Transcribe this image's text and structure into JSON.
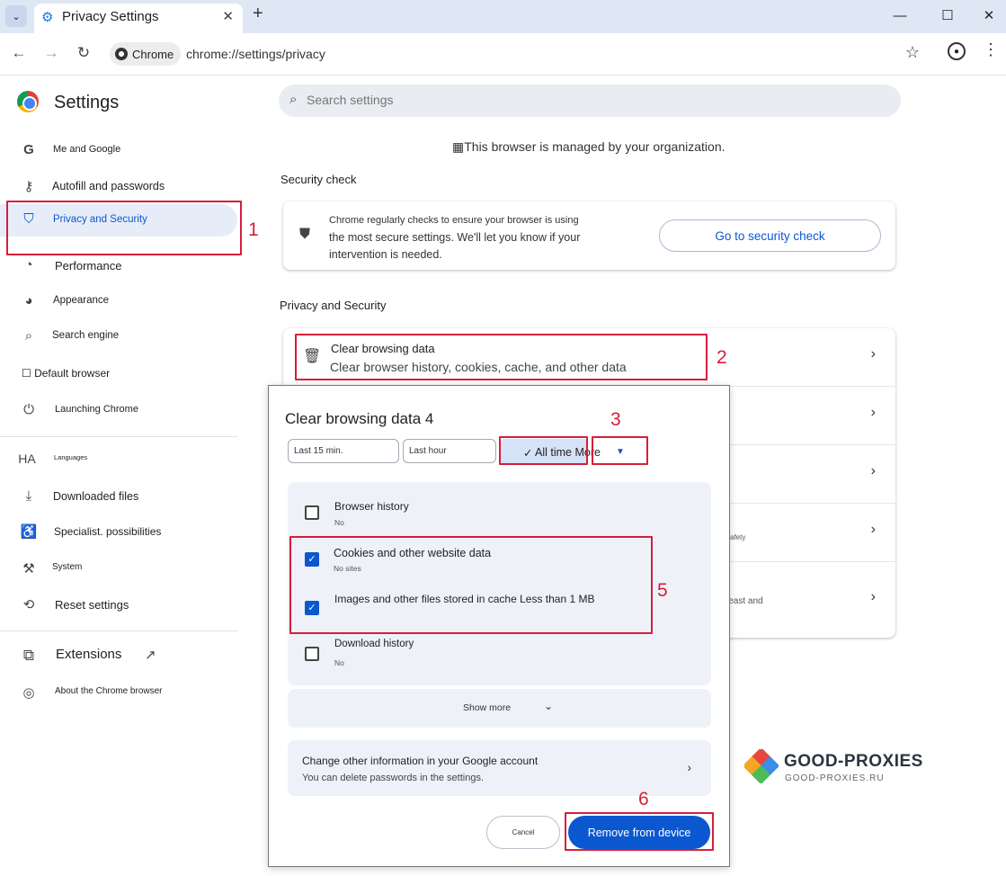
{
  "window": {
    "tab_title": "Privacy Settings",
    "url_chip": "Chrome",
    "url": "chrome://settings/privacy"
  },
  "sidebar": {
    "title": "Settings",
    "items": [
      {
        "label": "Me and Google",
        "icon": "google-g-icon"
      },
      {
        "label": "Autofill and passwords",
        "icon": "key-icon"
      },
      {
        "label": "Privacy and Security",
        "icon": "shield-icon"
      },
      {
        "label": "Performance",
        "icon": "speedometer-icon"
      },
      {
        "label": "Appearance",
        "icon": "palette-icon"
      },
      {
        "label": "Search engine",
        "icon": "search-icon"
      },
      {
        "label": "☐ Default browser",
        "icon": ""
      },
      {
        "label": "Launching Chrome",
        "icon": "power-icon"
      },
      {
        "label": "Languages",
        "icon": "HA"
      },
      {
        "label": "Downloaded files",
        "icon": "download-icon"
      },
      {
        "label": "Specialist. possibilities",
        "icon": "accessibility-icon"
      },
      {
        "label": "System",
        "icon": "wrench-icon"
      },
      {
        "label": "Reset settings",
        "icon": "reset-icon"
      },
      {
        "label": "Extensions",
        "icon": "puzzle-icon"
      },
      {
        "label": "About the Chrome browser",
        "icon": "chrome-icon"
      }
    ]
  },
  "main": {
    "search_placeholder": "Search settings",
    "managed_notice": "This browser is managed by your organization.",
    "security_check": {
      "heading": "Security check",
      "description_line1": "Chrome regularly checks to ensure your browser is using",
      "description_line2": "the most secure settings. We'll let you know if your",
      "description_line3": "intervention is needed.",
      "button": "Go to security check"
    },
    "privacy_section": {
      "heading": "Privacy and Security",
      "clear_title": "Clear browsing data",
      "clear_subtitle": "Clear browser history, cookies, cache, and other data",
      "fragment_safety": "safety",
      "fragment_least": "least and"
    }
  },
  "dialog": {
    "title": "Clear browsing data 4",
    "time_options": [
      "Last 15 min.",
      "Last hour"
    ],
    "selected_time": "All time More",
    "options": [
      {
        "title": "Browser history",
        "subtitle": "No",
        "checked": false
      },
      {
        "title": "Cookies and other website data",
        "subtitle": "No sites",
        "checked": true
      },
      {
        "title": "Images and other files stored in cache Less than 1 MB",
        "subtitle": "",
        "checked": true
      },
      {
        "title": "Download history",
        "subtitle": "No",
        "checked": false
      }
    ],
    "show_more": "Show more",
    "account_title": "Change other information in your Google account",
    "account_subtitle": "You can delete passwords in the settings.",
    "cancel": "Cancel",
    "remove": "Remove from device"
  },
  "annotations": [
    "1",
    "2",
    "3",
    "5",
    "6"
  ],
  "watermark": {
    "brand": "GOOD-PROXIES",
    "url": "GOOD-PROXIES.RU"
  },
  "colors": {
    "accent": "#0b57d0",
    "annotation": "#d41f3a",
    "titlebar": "#dfe7f5"
  }
}
